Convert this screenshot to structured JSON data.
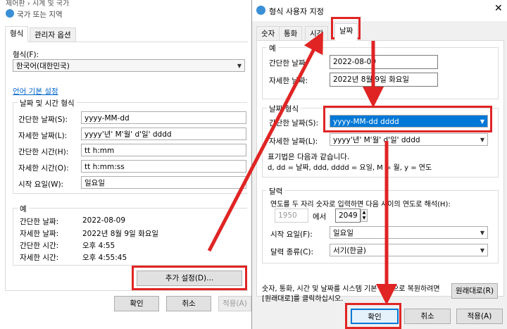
{
  "bg": {
    "breadcrumb": "제어판 › 시계 및 국가",
    "title": "국가 또는 지역",
    "tabs": [
      "형식",
      "관리자 옵션"
    ],
    "format_label": "형식(F):",
    "format_value": "한국어(대한민국)",
    "lang_link": "언어 기본 설정",
    "datetime_group": "날짜 및 시간 형식",
    "rows": [
      {
        "label": "간단한 날짜(S):",
        "value": "yyyy-MM-dd"
      },
      {
        "label": "자세한 날짜(L):",
        "value": "yyyy'년' M'월' d'일' dddd"
      },
      {
        "label": "간단한 시간(H):",
        "value": "tt h:mm"
      },
      {
        "label": "자세한 시간(O):",
        "value": "tt h:mm:ss"
      },
      {
        "label": "시작 요일(W):",
        "value": "일요일"
      }
    ],
    "example_group": "예",
    "examples": [
      {
        "label": "간단한 날짜:",
        "value": "2022-08-09"
      },
      {
        "label": "자세한 날짜:",
        "value": "2022년 8월 9일 화요일"
      },
      {
        "label": "간단한 시간:",
        "value": "오후 4:55"
      },
      {
        "label": "자세한 시간:",
        "value": "오후 4:55:45"
      }
    ],
    "additional_settings": "추가 설정(D)...",
    "ok": "확인",
    "cancel": "취소",
    "apply": "적용(A)"
  },
  "dlg": {
    "title": "형식 사용자 지정",
    "tabs": [
      "숫자",
      "통화",
      "시간",
      "날짜"
    ],
    "example_group": "예",
    "short_label": "간단한 날짜:",
    "short_value": "2022-08-09",
    "long_label": "자세한 날짜:",
    "long_value": "2022년 8월 9일 화요일",
    "date_format_group": "날짜 형식",
    "short_fmt_label": "간단한 날짜(S):",
    "short_fmt_value": "yyyy-MM-dd dddd",
    "long_fmt_label": "자세한 날짜(L):",
    "long_fmt_value": "yyyy'년' M'월' d'일' dddd",
    "notation_line1": "표기법은 다음과 같습니다.",
    "notation_line2": "d, dd = 날짜,  ddd, dddd = 요일,  M = 월,  y = 연도",
    "calendar_group": "달력",
    "two_digit_text": "연도를 두 자리 숫자로 입력하면 다음 사이의 연도로 해석(H):",
    "year_from": "1950",
    "and_text": "에서",
    "year_to": "2049",
    "first_day_label": "시작 요일(F):",
    "first_day_value": "일요일",
    "cal_type_label": "달력 종류(C):",
    "cal_type_value": "서기(한글)",
    "reset_text_1": "숫자, 통화, 시간 및 날짜를 시스템 기본 설정으로 복원하려면",
    "reset_text_2": "[원래대로]를 클릭하십시오.",
    "reset_button": "원래대로(R)",
    "ok": "확인",
    "cancel": "취소",
    "apply": "적용(A)"
  },
  "colors": {
    "accent": "#0078d7",
    "annotation_red": "#e02424"
  }
}
